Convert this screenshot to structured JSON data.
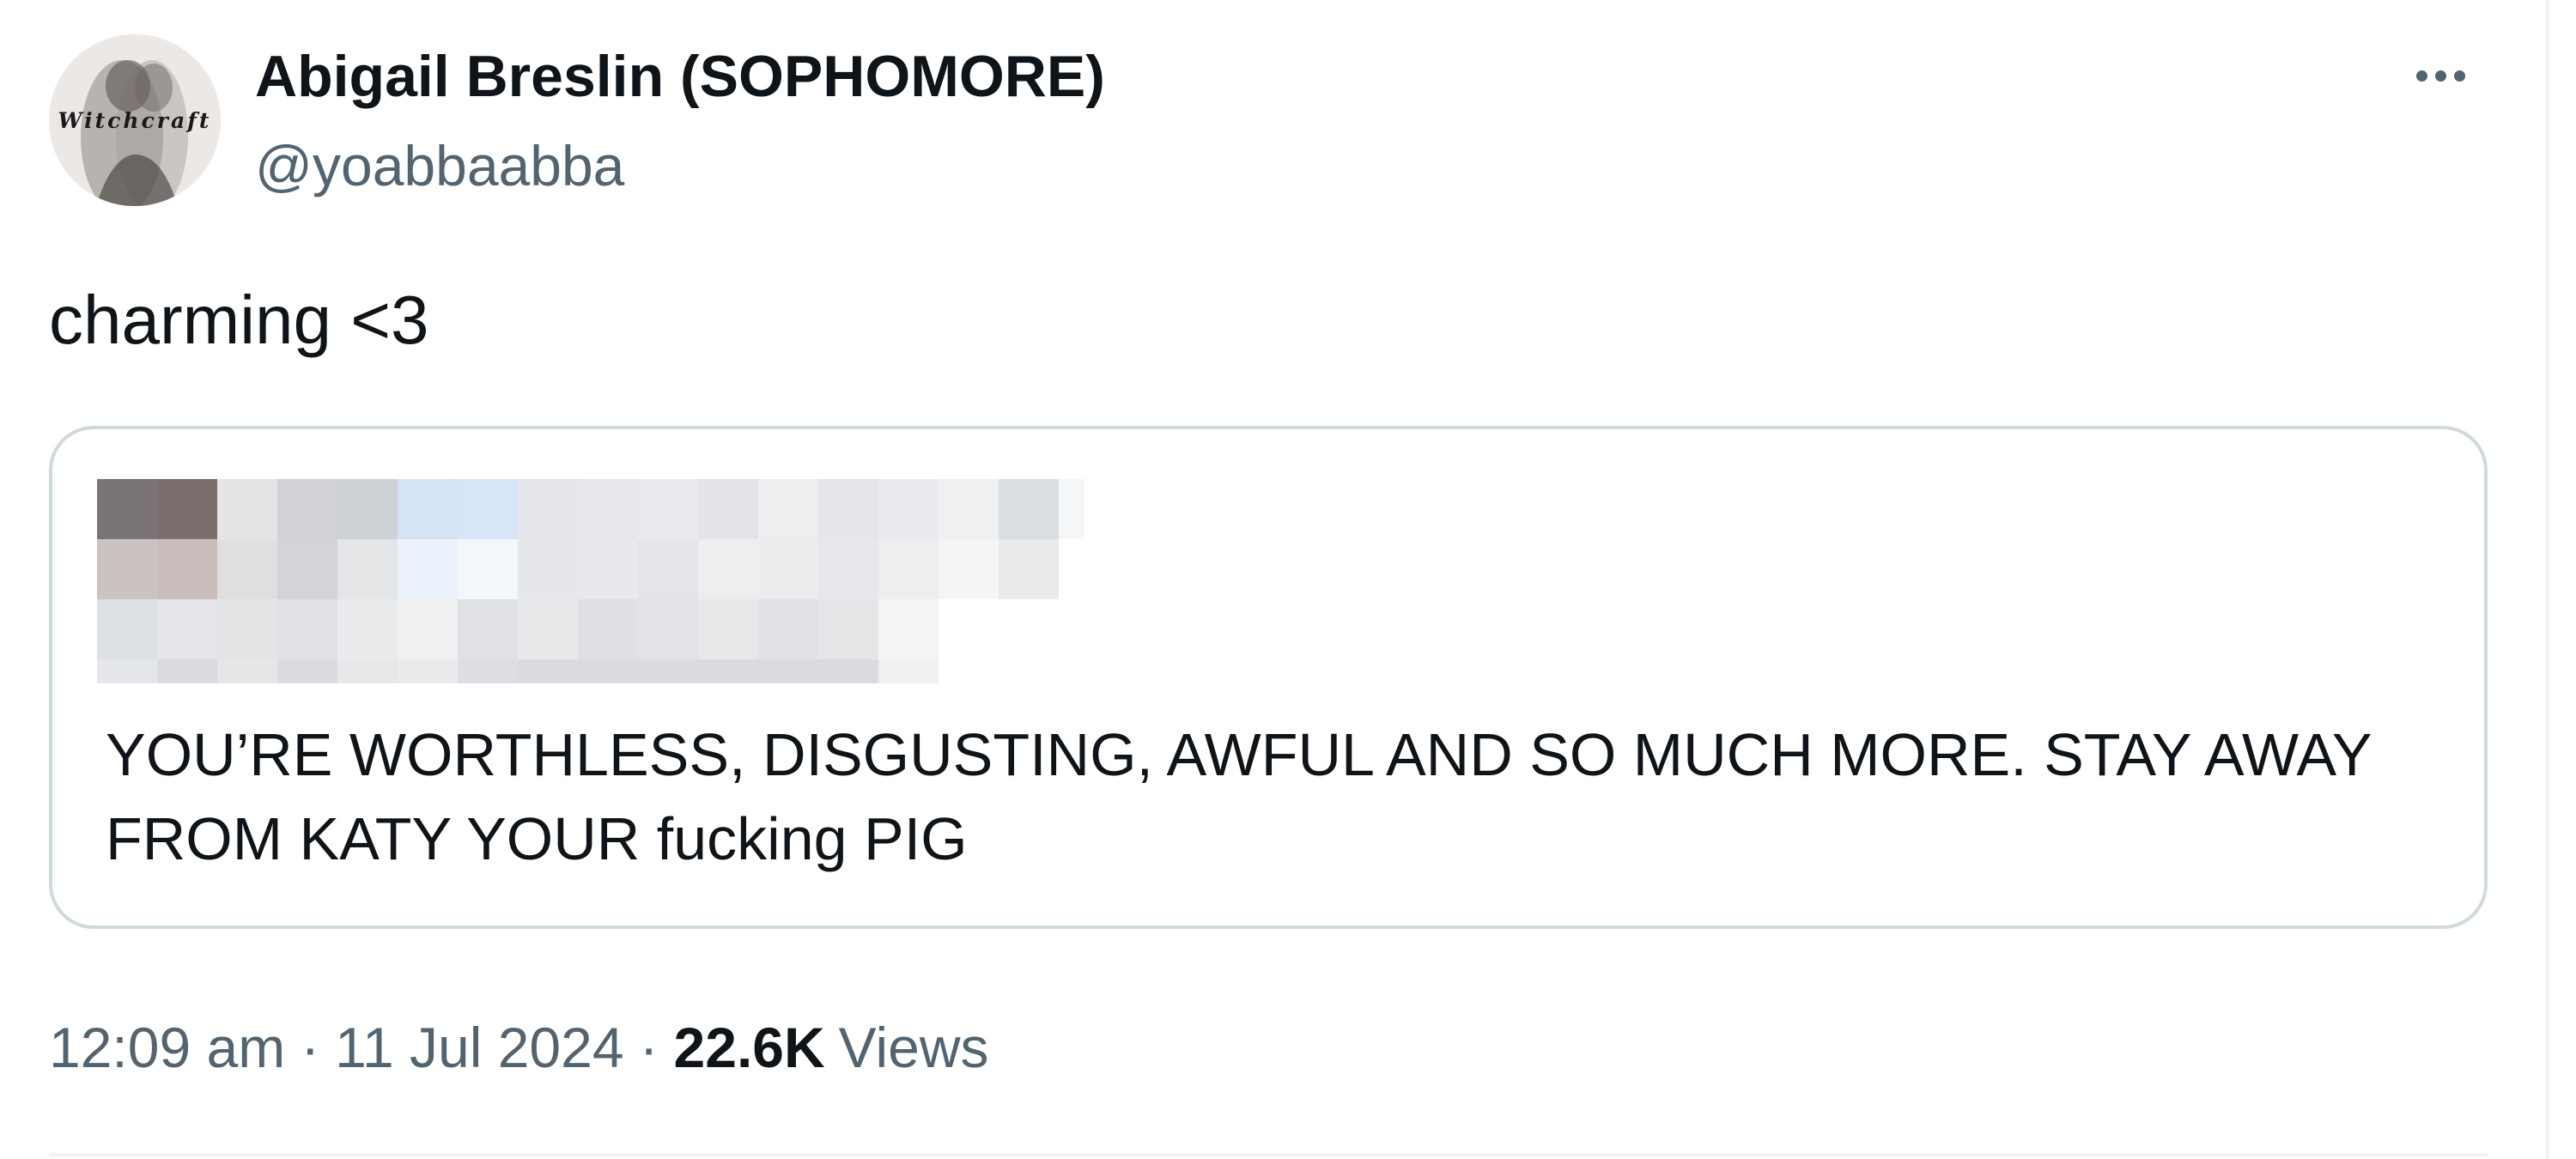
{
  "author": {
    "name": "Abigail Breslin (SOPHOMORE)",
    "handle": "@yoabbaabba",
    "avatar_text": "Witchcraft"
  },
  "more_icon": "more-horizontal-icon",
  "tweet": {
    "text": "charming <3"
  },
  "quote": {
    "text": "YOU’RE WORTHLESS, DISGUSTING, AWFUL AND SO MUCH MORE. STAY AWAY FROM KATY YOUR fucking PIG",
    "header_redacted": true
  },
  "meta": {
    "time": "12:09 am",
    "separator": "·",
    "date": "11 Jul 2024",
    "views_count": "22.6K",
    "views_label": "Views"
  },
  "colors": {
    "text_primary": "#0f1419",
    "text_secondary": "#536471",
    "border": "#cfd9de",
    "divider": "#eff3f4"
  }
}
